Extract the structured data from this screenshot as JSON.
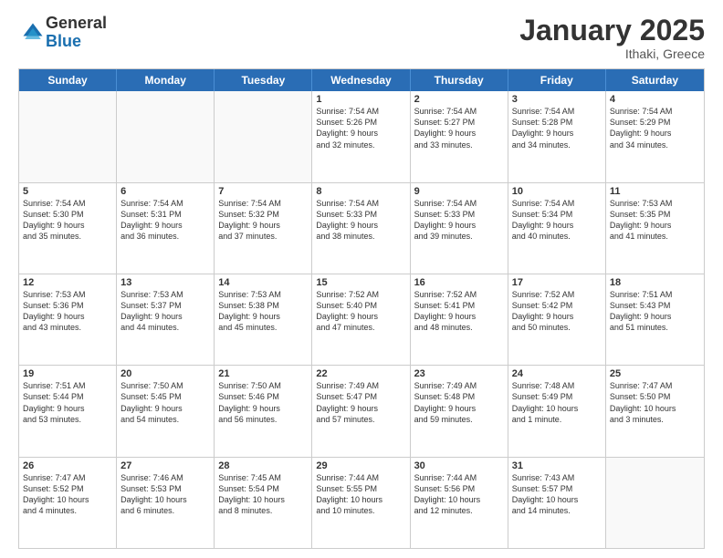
{
  "logo": {
    "general": "General",
    "blue": "Blue"
  },
  "title": "January 2025",
  "subtitle": "Ithaki, Greece",
  "days": [
    "Sunday",
    "Monday",
    "Tuesday",
    "Wednesday",
    "Thursday",
    "Friday",
    "Saturday"
  ],
  "rows": [
    [
      {
        "day": "",
        "empty": true
      },
      {
        "day": "",
        "empty": true
      },
      {
        "day": "",
        "empty": true
      },
      {
        "day": "1",
        "lines": [
          "Sunrise: 7:54 AM",
          "Sunset: 5:26 PM",
          "Daylight: 9 hours",
          "and 32 minutes."
        ]
      },
      {
        "day": "2",
        "lines": [
          "Sunrise: 7:54 AM",
          "Sunset: 5:27 PM",
          "Daylight: 9 hours",
          "and 33 minutes."
        ]
      },
      {
        "day": "3",
        "lines": [
          "Sunrise: 7:54 AM",
          "Sunset: 5:28 PM",
          "Daylight: 9 hours",
          "and 34 minutes."
        ]
      },
      {
        "day": "4",
        "lines": [
          "Sunrise: 7:54 AM",
          "Sunset: 5:29 PM",
          "Daylight: 9 hours",
          "and 34 minutes."
        ]
      }
    ],
    [
      {
        "day": "5",
        "lines": [
          "Sunrise: 7:54 AM",
          "Sunset: 5:30 PM",
          "Daylight: 9 hours",
          "and 35 minutes."
        ]
      },
      {
        "day": "6",
        "lines": [
          "Sunrise: 7:54 AM",
          "Sunset: 5:31 PM",
          "Daylight: 9 hours",
          "and 36 minutes."
        ]
      },
      {
        "day": "7",
        "lines": [
          "Sunrise: 7:54 AM",
          "Sunset: 5:32 PM",
          "Daylight: 9 hours",
          "and 37 minutes."
        ]
      },
      {
        "day": "8",
        "lines": [
          "Sunrise: 7:54 AM",
          "Sunset: 5:33 PM",
          "Daylight: 9 hours",
          "and 38 minutes."
        ]
      },
      {
        "day": "9",
        "lines": [
          "Sunrise: 7:54 AM",
          "Sunset: 5:33 PM",
          "Daylight: 9 hours",
          "and 39 minutes."
        ]
      },
      {
        "day": "10",
        "lines": [
          "Sunrise: 7:54 AM",
          "Sunset: 5:34 PM",
          "Daylight: 9 hours",
          "and 40 minutes."
        ]
      },
      {
        "day": "11",
        "lines": [
          "Sunrise: 7:53 AM",
          "Sunset: 5:35 PM",
          "Daylight: 9 hours",
          "and 41 minutes."
        ]
      }
    ],
    [
      {
        "day": "12",
        "lines": [
          "Sunrise: 7:53 AM",
          "Sunset: 5:36 PM",
          "Daylight: 9 hours",
          "and 43 minutes."
        ]
      },
      {
        "day": "13",
        "lines": [
          "Sunrise: 7:53 AM",
          "Sunset: 5:37 PM",
          "Daylight: 9 hours",
          "and 44 minutes."
        ]
      },
      {
        "day": "14",
        "lines": [
          "Sunrise: 7:53 AM",
          "Sunset: 5:38 PM",
          "Daylight: 9 hours",
          "and 45 minutes."
        ]
      },
      {
        "day": "15",
        "lines": [
          "Sunrise: 7:52 AM",
          "Sunset: 5:40 PM",
          "Daylight: 9 hours",
          "and 47 minutes."
        ]
      },
      {
        "day": "16",
        "lines": [
          "Sunrise: 7:52 AM",
          "Sunset: 5:41 PM",
          "Daylight: 9 hours",
          "and 48 minutes."
        ]
      },
      {
        "day": "17",
        "lines": [
          "Sunrise: 7:52 AM",
          "Sunset: 5:42 PM",
          "Daylight: 9 hours",
          "and 50 minutes."
        ]
      },
      {
        "day": "18",
        "lines": [
          "Sunrise: 7:51 AM",
          "Sunset: 5:43 PM",
          "Daylight: 9 hours",
          "and 51 minutes."
        ]
      }
    ],
    [
      {
        "day": "19",
        "lines": [
          "Sunrise: 7:51 AM",
          "Sunset: 5:44 PM",
          "Daylight: 9 hours",
          "and 53 minutes."
        ]
      },
      {
        "day": "20",
        "lines": [
          "Sunrise: 7:50 AM",
          "Sunset: 5:45 PM",
          "Daylight: 9 hours",
          "and 54 minutes."
        ]
      },
      {
        "day": "21",
        "lines": [
          "Sunrise: 7:50 AM",
          "Sunset: 5:46 PM",
          "Daylight: 9 hours",
          "and 56 minutes."
        ]
      },
      {
        "day": "22",
        "lines": [
          "Sunrise: 7:49 AM",
          "Sunset: 5:47 PM",
          "Daylight: 9 hours",
          "and 57 minutes."
        ]
      },
      {
        "day": "23",
        "lines": [
          "Sunrise: 7:49 AM",
          "Sunset: 5:48 PM",
          "Daylight: 9 hours",
          "and 59 minutes."
        ]
      },
      {
        "day": "24",
        "lines": [
          "Sunrise: 7:48 AM",
          "Sunset: 5:49 PM",
          "Daylight: 10 hours",
          "and 1 minute."
        ]
      },
      {
        "day": "25",
        "lines": [
          "Sunrise: 7:47 AM",
          "Sunset: 5:50 PM",
          "Daylight: 10 hours",
          "and 3 minutes."
        ]
      }
    ],
    [
      {
        "day": "26",
        "lines": [
          "Sunrise: 7:47 AM",
          "Sunset: 5:52 PM",
          "Daylight: 10 hours",
          "and 4 minutes."
        ]
      },
      {
        "day": "27",
        "lines": [
          "Sunrise: 7:46 AM",
          "Sunset: 5:53 PM",
          "Daylight: 10 hours",
          "and 6 minutes."
        ]
      },
      {
        "day": "28",
        "lines": [
          "Sunrise: 7:45 AM",
          "Sunset: 5:54 PM",
          "Daylight: 10 hours",
          "and 8 minutes."
        ]
      },
      {
        "day": "29",
        "lines": [
          "Sunrise: 7:44 AM",
          "Sunset: 5:55 PM",
          "Daylight: 10 hours",
          "and 10 minutes."
        ]
      },
      {
        "day": "30",
        "lines": [
          "Sunrise: 7:44 AM",
          "Sunset: 5:56 PM",
          "Daylight: 10 hours",
          "and 12 minutes."
        ]
      },
      {
        "day": "31",
        "lines": [
          "Sunrise: 7:43 AM",
          "Sunset: 5:57 PM",
          "Daylight: 10 hours",
          "and 14 minutes."
        ]
      },
      {
        "day": "",
        "empty": true
      }
    ]
  ]
}
